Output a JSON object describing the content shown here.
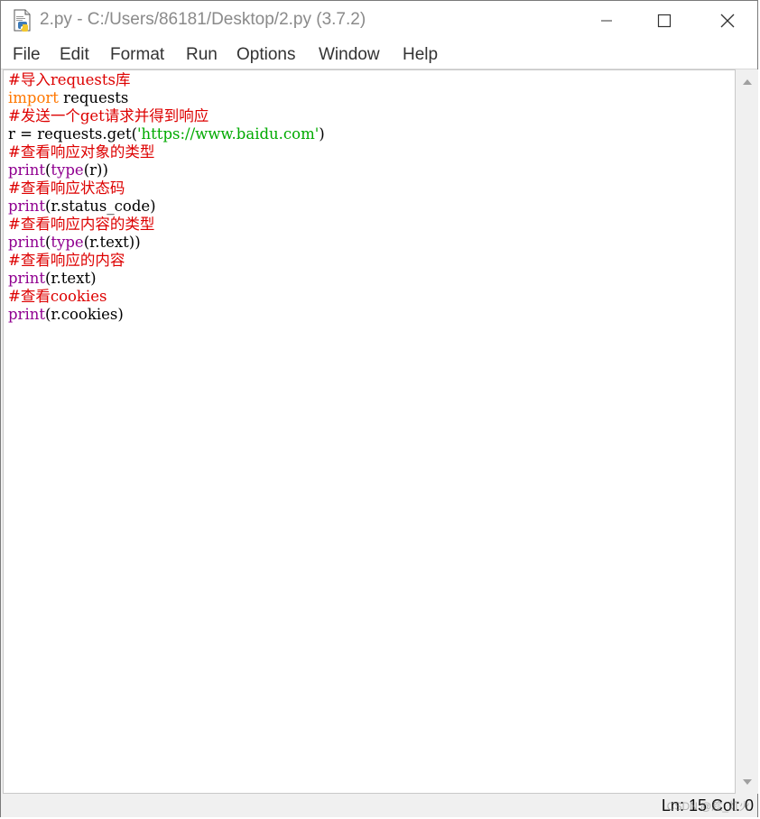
{
  "window": {
    "title": "2.py - C:/Users/86181/Desktop/2.py (3.7.2)",
    "app_icon": "python-file-icon",
    "controls": [
      "minimize-icon",
      "maximize-icon",
      "close-icon"
    ]
  },
  "menu": {
    "items": [
      {
        "label": "File"
      },
      {
        "label": "Edit"
      },
      {
        "label": "Format"
      },
      {
        "label": "Run"
      },
      {
        "label": "Options"
      },
      {
        "label": "Window"
      },
      {
        "label": "Help"
      }
    ]
  },
  "editor": {
    "lines": [
      [
        {
          "t": "#导入requests库",
          "k": "comment"
        }
      ],
      [
        {
          "t": "import",
          "k": "keyword"
        },
        {
          "t": " requests",
          "k": "plain"
        }
      ],
      [
        {
          "t": "#发送一个get请求并得到响应",
          "k": "comment"
        }
      ],
      [
        {
          "t": "r = requests.get(",
          "k": "plain"
        },
        {
          "t": "'https://www.baidu.com'",
          "k": "string"
        },
        {
          "t": ")",
          "k": "plain"
        }
      ],
      [
        {
          "t": "#查看响应对象的类型",
          "k": "comment"
        }
      ],
      [
        {
          "t": "print",
          "k": "builtin"
        },
        {
          "t": "(",
          "k": "plain"
        },
        {
          "t": "type",
          "k": "builtin"
        },
        {
          "t": "(r))",
          "k": "plain"
        }
      ],
      [
        {
          "t": "#查看响应状态码",
          "k": "comment"
        }
      ],
      [
        {
          "t": "print",
          "k": "builtin"
        },
        {
          "t": "(r.status_code)",
          "k": "plain"
        }
      ],
      [
        {
          "t": "#查看响应内容的类型",
          "k": "comment"
        }
      ],
      [
        {
          "t": "print",
          "k": "builtin"
        },
        {
          "t": "(",
          "k": "plain"
        },
        {
          "t": "type",
          "k": "builtin"
        },
        {
          "t": "(r.text))",
          "k": "plain"
        }
      ],
      [
        {
          "t": "#查看响应的内容",
          "k": "comment"
        }
      ],
      [
        {
          "t": "print",
          "k": "builtin"
        },
        {
          "t": "(r.text)",
          "k": "plain"
        }
      ],
      [
        {
          "t": "#查看cookies",
          "k": "comment"
        }
      ],
      [
        {
          "t": "print",
          "k": "builtin"
        },
        {
          "t": "(r.cookies)",
          "k": "plain"
        }
      ]
    ],
    "colors": {
      "comment": "#dd0000",
      "keyword": "#ff7700",
      "builtin": "#900090",
      "string": "#00aa00",
      "plain": "#000000"
    }
  },
  "scrollbar": {
    "up_icon": "arrow-up-icon",
    "down_icon": "arrow-down-icon"
  },
  "status": {
    "position": "Ln: 15  Col: 0",
    "watermark": "CSDN @趁_灯火"
  }
}
